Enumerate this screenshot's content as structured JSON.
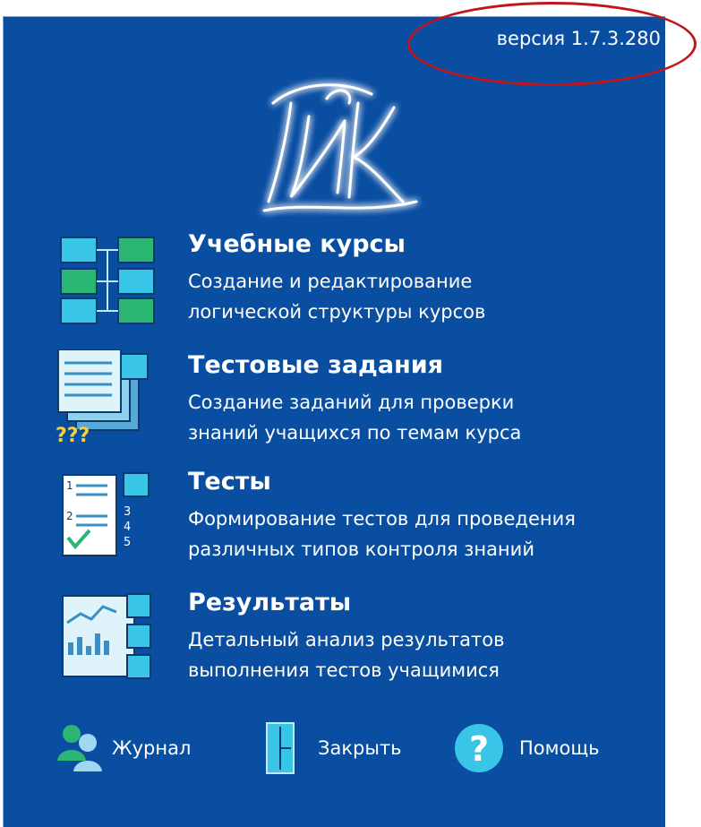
{
  "version": "версия 1.7.3.280",
  "logo_text": "ГИАК",
  "menu": [
    {
      "title": "Учебные курсы",
      "line1": "Создание и редактирование",
      "line2": "логической структуры курсов",
      "icon": "course-structure-icon"
    },
    {
      "title": "Тестовые задания",
      "line1": "Создание заданий для проверки",
      "line2": "знаний учащихся по темам курса",
      "icon": "test-tasks-icon"
    },
    {
      "title": "Тесты",
      "line1": "Формирование тестов для проведения",
      "line2": "различных типов контроля знаний",
      "icon": "tests-icon"
    },
    {
      "title": "Результаты",
      "line1": "Детальный анализ результатов",
      "line2": "выполнения тестов учащимися",
      "icon": "results-icon"
    }
  ],
  "icon_text": {
    "questions": "???",
    "n1": "1",
    "n2": "2",
    "n3": "3",
    "n4": "4",
    "n5": "5"
  },
  "footer": {
    "journal": "Журнал",
    "close": "Закрыть",
    "help": "Помощь",
    "help_glyph": "?"
  },
  "colors": {
    "background": "#0a4ea2",
    "highlight_oval": "#c0151c",
    "icon_cyan": "#39c5e8",
    "icon_green": "#2bb673"
  }
}
